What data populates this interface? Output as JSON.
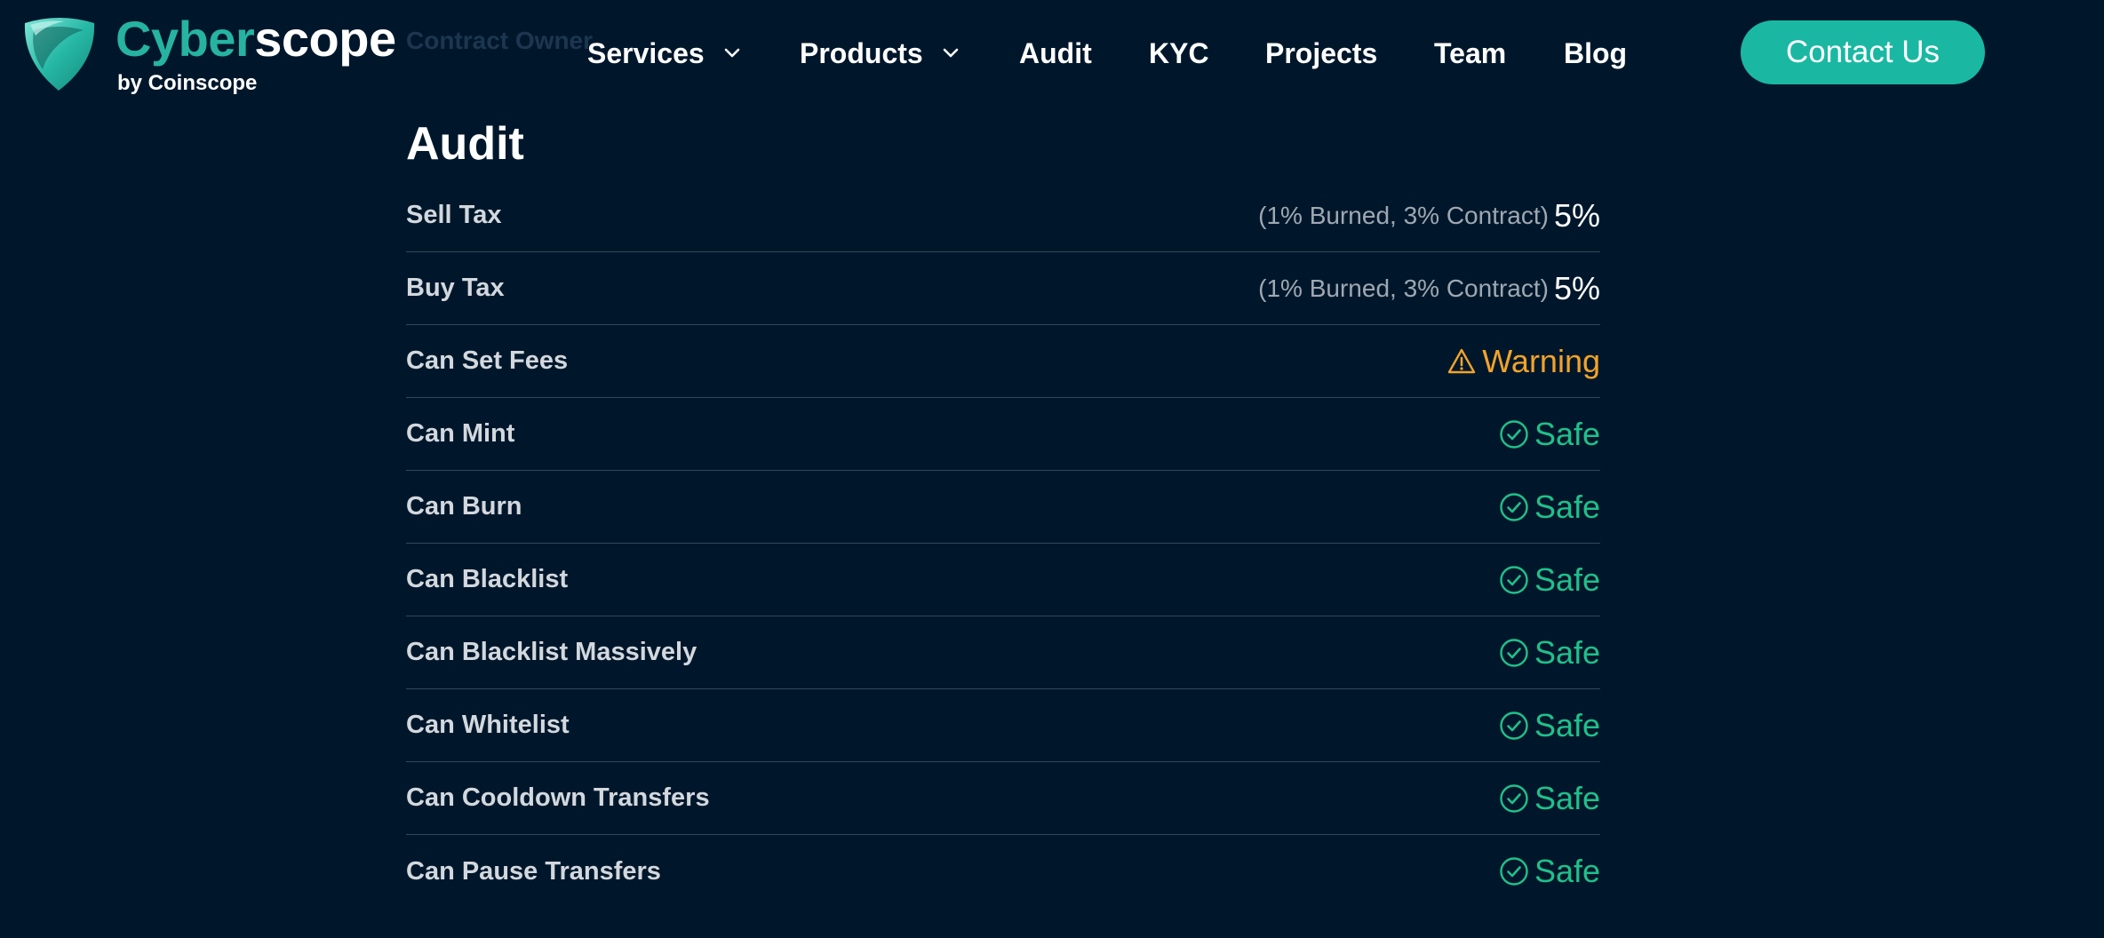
{
  "header": {
    "ghost_text": "Contract Owner",
    "logo": {
      "title_part1": "Cyber",
      "title_part2": "scope",
      "subtitle": "by Coinscope"
    },
    "nav": [
      {
        "label": "Services",
        "has_dropdown": true
      },
      {
        "label": "Products",
        "has_dropdown": true
      },
      {
        "label": "Audit",
        "has_dropdown": false
      },
      {
        "label": "KYC",
        "has_dropdown": false
      },
      {
        "label": "Projects",
        "has_dropdown": false
      },
      {
        "label": "Team",
        "has_dropdown": false
      },
      {
        "label": "Blog",
        "has_dropdown": false
      }
    ],
    "contact_label": "Contact Us"
  },
  "audit": {
    "title": "Audit",
    "rows": [
      {
        "label": "Sell Tax",
        "note": "(1% Burned, 3% Contract)",
        "value": "5%"
      },
      {
        "label": "Buy Tax",
        "note": "(1% Burned, 3% Contract)",
        "value": "5%"
      },
      {
        "label": "Can Set Fees",
        "status": "Warning"
      },
      {
        "label": "Can Mint",
        "status": "Safe"
      },
      {
        "label": "Can Burn",
        "status": "Safe"
      },
      {
        "label": "Can Blacklist",
        "status": "Safe"
      },
      {
        "label": "Can Blacklist Massively",
        "status": "Safe"
      },
      {
        "label": "Can Whitelist",
        "status": "Safe"
      },
      {
        "label": "Can Cooldown Transfers",
        "status": "Safe"
      },
      {
        "label": "Can Pause Transfers",
        "status": "Safe"
      }
    ]
  },
  "colors": {
    "background": "#00172b",
    "accent": "#1ab8a2",
    "safe": "#20c08a",
    "warning": "#f2a32a"
  },
  "icons": {
    "logo": "shield-logo-icon",
    "dropdown": "chevron-down-icon",
    "safe": "check-circle-icon",
    "warning": "warning-triangle-icon"
  }
}
